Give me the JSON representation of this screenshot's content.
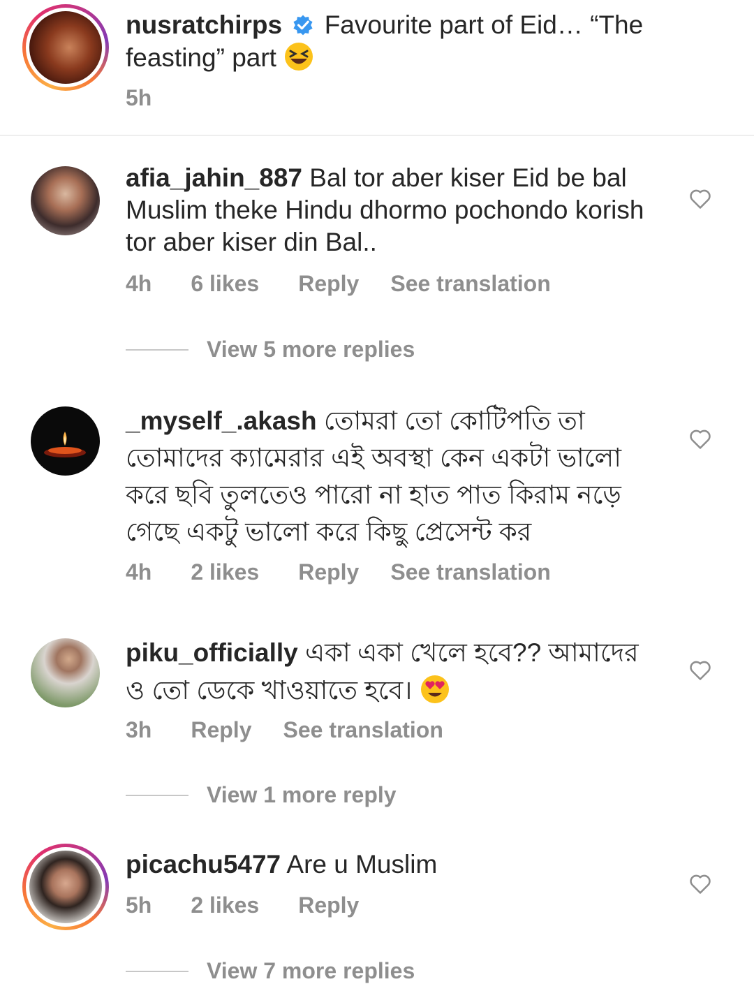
{
  "caption": {
    "username": "nusratchirps",
    "text": "Favourite part of Eid… “The feasting” part",
    "time": "5h"
  },
  "comments": [
    {
      "username": "afia_jahin_887",
      "text": "Bal tor aber kiser Eid be bal Muslim theke Hindu dhormo pochondo korish tor aber kiser din Bal..",
      "time": "4h",
      "likes": "6 likes",
      "reply": "Reply",
      "translate": "See translation",
      "more_replies": "View 5 more replies"
    },
    {
      "username": "_myself_.akash",
      "text": "তোমরা তো কোটিপতি তা তোমাদের ক্যামেরার এই অবস্থা কেন একটা ভালো করে ছবি তুলতেও পারো না হাত পাত কিরাম নড়ে গেছে একটু ভালো করে কিছু প্রেসেন্ট কর",
      "time": "4h",
      "likes": "2 likes",
      "reply": "Reply",
      "translate": "See translation"
    },
    {
      "username": "piku_officially",
      "text": "একা একা খেলে হবে?? আমাদের ও তো ডেকে খাওয়াতে হবে।",
      "time": "3h",
      "reply": "Reply",
      "translate": "See translation",
      "more_replies": "View 1 more reply"
    },
    {
      "username": "picachu5477",
      "text": "Are u Muslim",
      "time": "5h",
      "likes": "2 likes",
      "reply": "Reply",
      "more_replies": "View 7 more replies"
    }
  ],
  "colors": {
    "text": "#262626",
    "muted": "#8e8e8e",
    "verified": "#3897f0",
    "divider": "#dbdbdb"
  },
  "icons": [
    "verified-badge-icon",
    "laughing-emoji-icon",
    "heart-eyes-emoji-icon",
    "heart-outline-icon"
  ]
}
